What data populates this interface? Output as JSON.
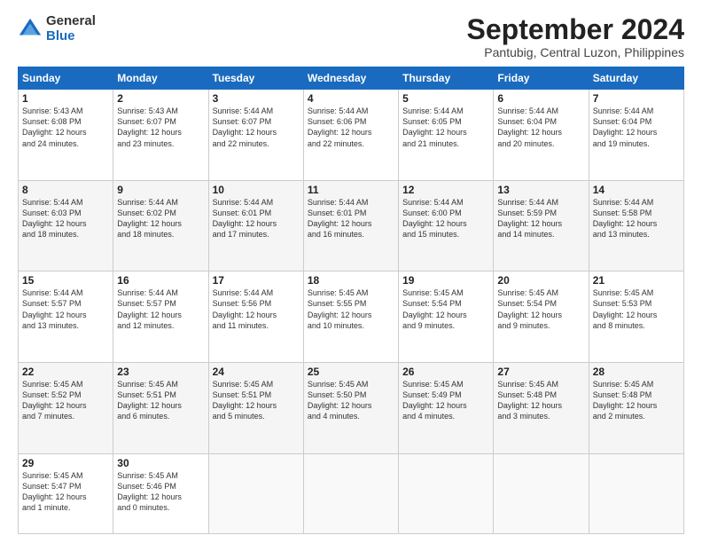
{
  "header": {
    "logo_general": "General",
    "logo_blue": "Blue",
    "month_title": "September 2024",
    "location": "Pantubig, Central Luzon, Philippines"
  },
  "weekdays": [
    "Sunday",
    "Monday",
    "Tuesday",
    "Wednesday",
    "Thursday",
    "Friday",
    "Saturday"
  ],
  "weeks": [
    [
      {
        "day": "1",
        "info": "Sunrise: 5:43 AM\nSunset: 6:08 PM\nDaylight: 12 hours\nand 24 minutes."
      },
      {
        "day": "2",
        "info": "Sunrise: 5:43 AM\nSunset: 6:07 PM\nDaylight: 12 hours\nand 23 minutes."
      },
      {
        "day": "3",
        "info": "Sunrise: 5:44 AM\nSunset: 6:07 PM\nDaylight: 12 hours\nand 22 minutes."
      },
      {
        "day": "4",
        "info": "Sunrise: 5:44 AM\nSunset: 6:06 PM\nDaylight: 12 hours\nand 22 minutes."
      },
      {
        "day": "5",
        "info": "Sunrise: 5:44 AM\nSunset: 6:05 PM\nDaylight: 12 hours\nand 21 minutes."
      },
      {
        "day": "6",
        "info": "Sunrise: 5:44 AM\nSunset: 6:04 PM\nDaylight: 12 hours\nand 20 minutes."
      },
      {
        "day": "7",
        "info": "Sunrise: 5:44 AM\nSunset: 6:04 PM\nDaylight: 12 hours\nand 19 minutes."
      }
    ],
    [
      {
        "day": "8",
        "info": "Sunrise: 5:44 AM\nSunset: 6:03 PM\nDaylight: 12 hours\nand 18 minutes."
      },
      {
        "day": "9",
        "info": "Sunrise: 5:44 AM\nSunset: 6:02 PM\nDaylight: 12 hours\nand 18 minutes."
      },
      {
        "day": "10",
        "info": "Sunrise: 5:44 AM\nSunset: 6:01 PM\nDaylight: 12 hours\nand 17 minutes."
      },
      {
        "day": "11",
        "info": "Sunrise: 5:44 AM\nSunset: 6:01 PM\nDaylight: 12 hours\nand 16 minutes."
      },
      {
        "day": "12",
        "info": "Sunrise: 5:44 AM\nSunset: 6:00 PM\nDaylight: 12 hours\nand 15 minutes."
      },
      {
        "day": "13",
        "info": "Sunrise: 5:44 AM\nSunset: 5:59 PM\nDaylight: 12 hours\nand 14 minutes."
      },
      {
        "day": "14",
        "info": "Sunrise: 5:44 AM\nSunset: 5:58 PM\nDaylight: 12 hours\nand 13 minutes."
      }
    ],
    [
      {
        "day": "15",
        "info": "Sunrise: 5:44 AM\nSunset: 5:57 PM\nDaylight: 12 hours\nand 13 minutes."
      },
      {
        "day": "16",
        "info": "Sunrise: 5:44 AM\nSunset: 5:57 PM\nDaylight: 12 hours\nand 12 minutes."
      },
      {
        "day": "17",
        "info": "Sunrise: 5:44 AM\nSunset: 5:56 PM\nDaylight: 12 hours\nand 11 minutes."
      },
      {
        "day": "18",
        "info": "Sunrise: 5:45 AM\nSunset: 5:55 PM\nDaylight: 12 hours\nand 10 minutes."
      },
      {
        "day": "19",
        "info": "Sunrise: 5:45 AM\nSunset: 5:54 PM\nDaylight: 12 hours\nand 9 minutes."
      },
      {
        "day": "20",
        "info": "Sunrise: 5:45 AM\nSunset: 5:54 PM\nDaylight: 12 hours\nand 9 minutes."
      },
      {
        "day": "21",
        "info": "Sunrise: 5:45 AM\nSunset: 5:53 PM\nDaylight: 12 hours\nand 8 minutes."
      }
    ],
    [
      {
        "day": "22",
        "info": "Sunrise: 5:45 AM\nSunset: 5:52 PM\nDaylight: 12 hours\nand 7 minutes."
      },
      {
        "day": "23",
        "info": "Sunrise: 5:45 AM\nSunset: 5:51 PM\nDaylight: 12 hours\nand 6 minutes."
      },
      {
        "day": "24",
        "info": "Sunrise: 5:45 AM\nSunset: 5:51 PM\nDaylight: 12 hours\nand 5 minutes."
      },
      {
        "day": "25",
        "info": "Sunrise: 5:45 AM\nSunset: 5:50 PM\nDaylight: 12 hours\nand 4 minutes."
      },
      {
        "day": "26",
        "info": "Sunrise: 5:45 AM\nSunset: 5:49 PM\nDaylight: 12 hours\nand 4 minutes."
      },
      {
        "day": "27",
        "info": "Sunrise: 5:45 AM\nSunset: 5:48 PM\nDaylight: 12 hours\nand 3 minutes."
      },
      {
        "day": "28",
        "info": "Sunrise: 5:45 AM\nSunset: 5:48 PM\nDaylight: 12 hours\nand 2 minutes."
      }
    ],
    [
      {
        "day": "29",
        "info": "Sunrise: 5:45 AM\nSunset: 5:47 PM\nDaylight: 12 hours\nand 1 minute."
      },
      {
        "day": "30",
        "info": "Sunrise: 5:45 AM\nSunset: 5:46 PM\nDaylight: 12 hours\nand 0 minutes."
      },
      {
        "day": "",
        "info": ""
      },
      {
        "day": "",
        "info": ""
      },
      {
        "day": "",
        "info": ""
      },
      {
        "day": "",
        "info": ""
      },
      {
        "day": "",
        "info": ""
      }
    ]
  ]
}
